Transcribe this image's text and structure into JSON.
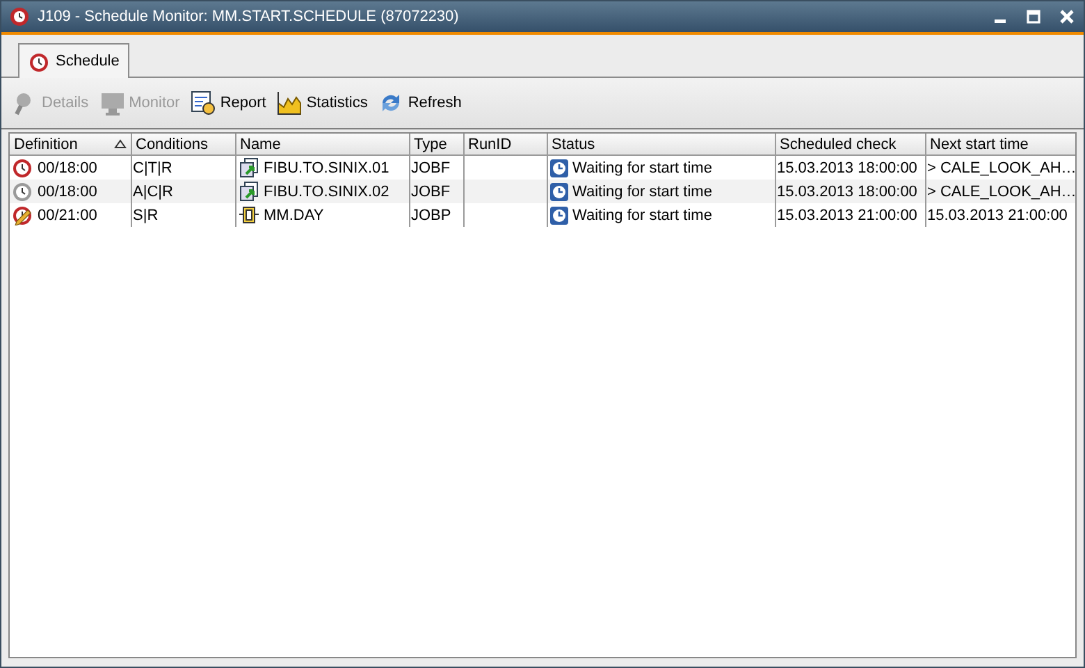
{
  "window": {
    "title": "J109 - Schedule Monitor: MM.START.SCHEDULE (87072230)"
  },
  "tabs": [
    {
      "label": "Schedule",
      "selected": true
    }
  ],
  "toolbar": [
    {
      "label": "Details",
      "kind": "details",
      "disabled": true
    },
    {
      "label": "Monitor",
      "kind": "monitor",
      "disabled": true
    },
    {
      "label": "Report",
      "kind": "report",
      "disabled": false
    },
    {
      "label": "Statistics",
      "kind": "statistics",
      "disabled": false
    },
    {
      "label": "Refresh",
      "kind": "refresh",
      "disabled": false
    }
  ],
  "table": {
    "columns": [
      {
        "label": "Definition",
        "sorted": true
      },
      {
        "label": "Conditions",
        "sorted": false
      },
      {
        "label": "Name",
        "sorted": false
      },
      {
        "label": "Type",
        "sorted": false
      },
      {
        "label": "RunID",
        "sorted": false
      },
      {
        "label": "Status",
        "sorted": false
      },
      {
        "label": "Scheduled check",
        "sorted": false
      },
      {
        "label": "Next start time",
        "sorted": false
      }
    ],
    "rows": [
      {
        "definition": {
          "text": "00/18:00",
          "kind": "active"
        },
        "conditions": "C|T|R",
        "name": {
          "text": "FIBU.TO.SINIX.01",
          "kind": "job"
        },
        "type": "JOBF",
        "status": "Waiting for start time",
        "scheduled_check": "15.03.2013 18:00:00",
        "next_start": "> CALE_LOOK_AH…"
      },
      {
        "definition": {
          "text": "00/18:00",
          "kind": "inactive"
        },
        "conditions": "A|C|R",
        "name": {
          "text": "FIBU.TO.SINIX.02",
          "kind": "job"
        },
        "type": "JOBF",
        "status": "Waiting for start time",
        "scheduled_check": "15.03.2013 18:00:00",
        "next_start": "> CALE_LOOK_AH…"
      },
      {
        "definition": {
          "text": "00/21:00",
          "kind": "edited"
        },
        "conditions": "S|R",
        "name": {
          "text": "MM.DAY",
          "kind": "plan"
        },
        "type": "JOBP",
        "status": "Waiting for start time",
        "scheduled_check": "15.03.2013 21:00:00",
        "next_start": "15.03.2013 21:00:00"
      }
    ]
  }
}
